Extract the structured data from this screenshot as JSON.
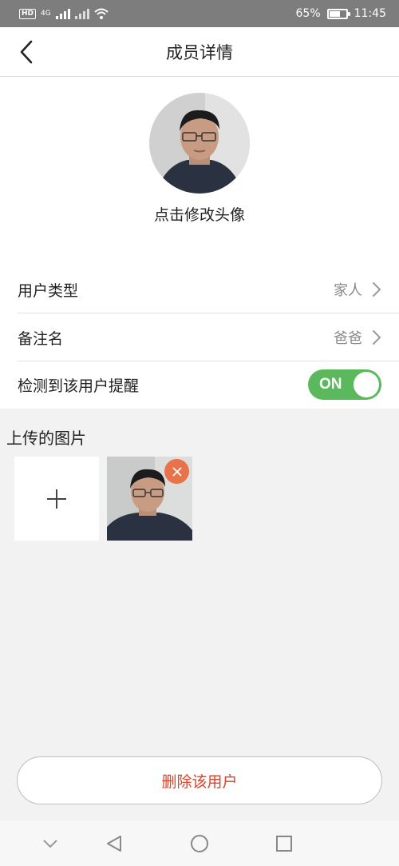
{
  "status_bar": {
    "hd": "HD",
    "network": "4G",
    "battery_percent": "65%",
    "battery_level": 0.65,
    "time": "11:45"
  },
  "header": {
    "title": "成员详情",
    "back_icon": "chevron-left-icon"
  },
  "profile": {
    "avatar_caption": "点击修改头像"
  },
  "settings": {
    "user_type": {
      "label": "用户类型",
      "value": "家人"
    },
    "remark_name": {
      "label": "备注名",
      "value": "爸爸"
    },
    "detection_alert": {
      "label": "检测到该用户提醒",
      "toggle_text": "ON",
      "enabled": true
    }
  },
  "uploads": {
    "title": "上传的图片",
    "add_icon": "plus-icon",
    "remove_icon": "close-icon"
  },
  "actions": {
    "delete_label": "删除该用户"
  },
  "colors": {
    "accent_green": "#5cb85c",
    "delete_red": "#d9432c",
    "badge_orange": "#e8724a"
  }
}
